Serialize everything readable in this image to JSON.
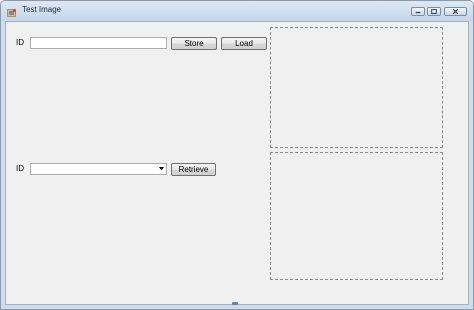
{
  "window": {
    "title": "Test Image",
    "controls": {
      "minimize": "minimize-icon",
      "maximize": "maximize-icon",
      "close": "close-icon"
    }
  },
  "store_row": {
    "label": "ID",
    "id_value": "",
    "store_button": "Store",
    "load_button": "Load"
  },
  "retrieve_row": {
    "label": "ID",
    "selected_value": "",
    "retrieve_button": "Retrieve"
  },
  "colors": {
    "client_background": "#f0f0f0",
    "titlebar": "#cfdcea"
  }
}
